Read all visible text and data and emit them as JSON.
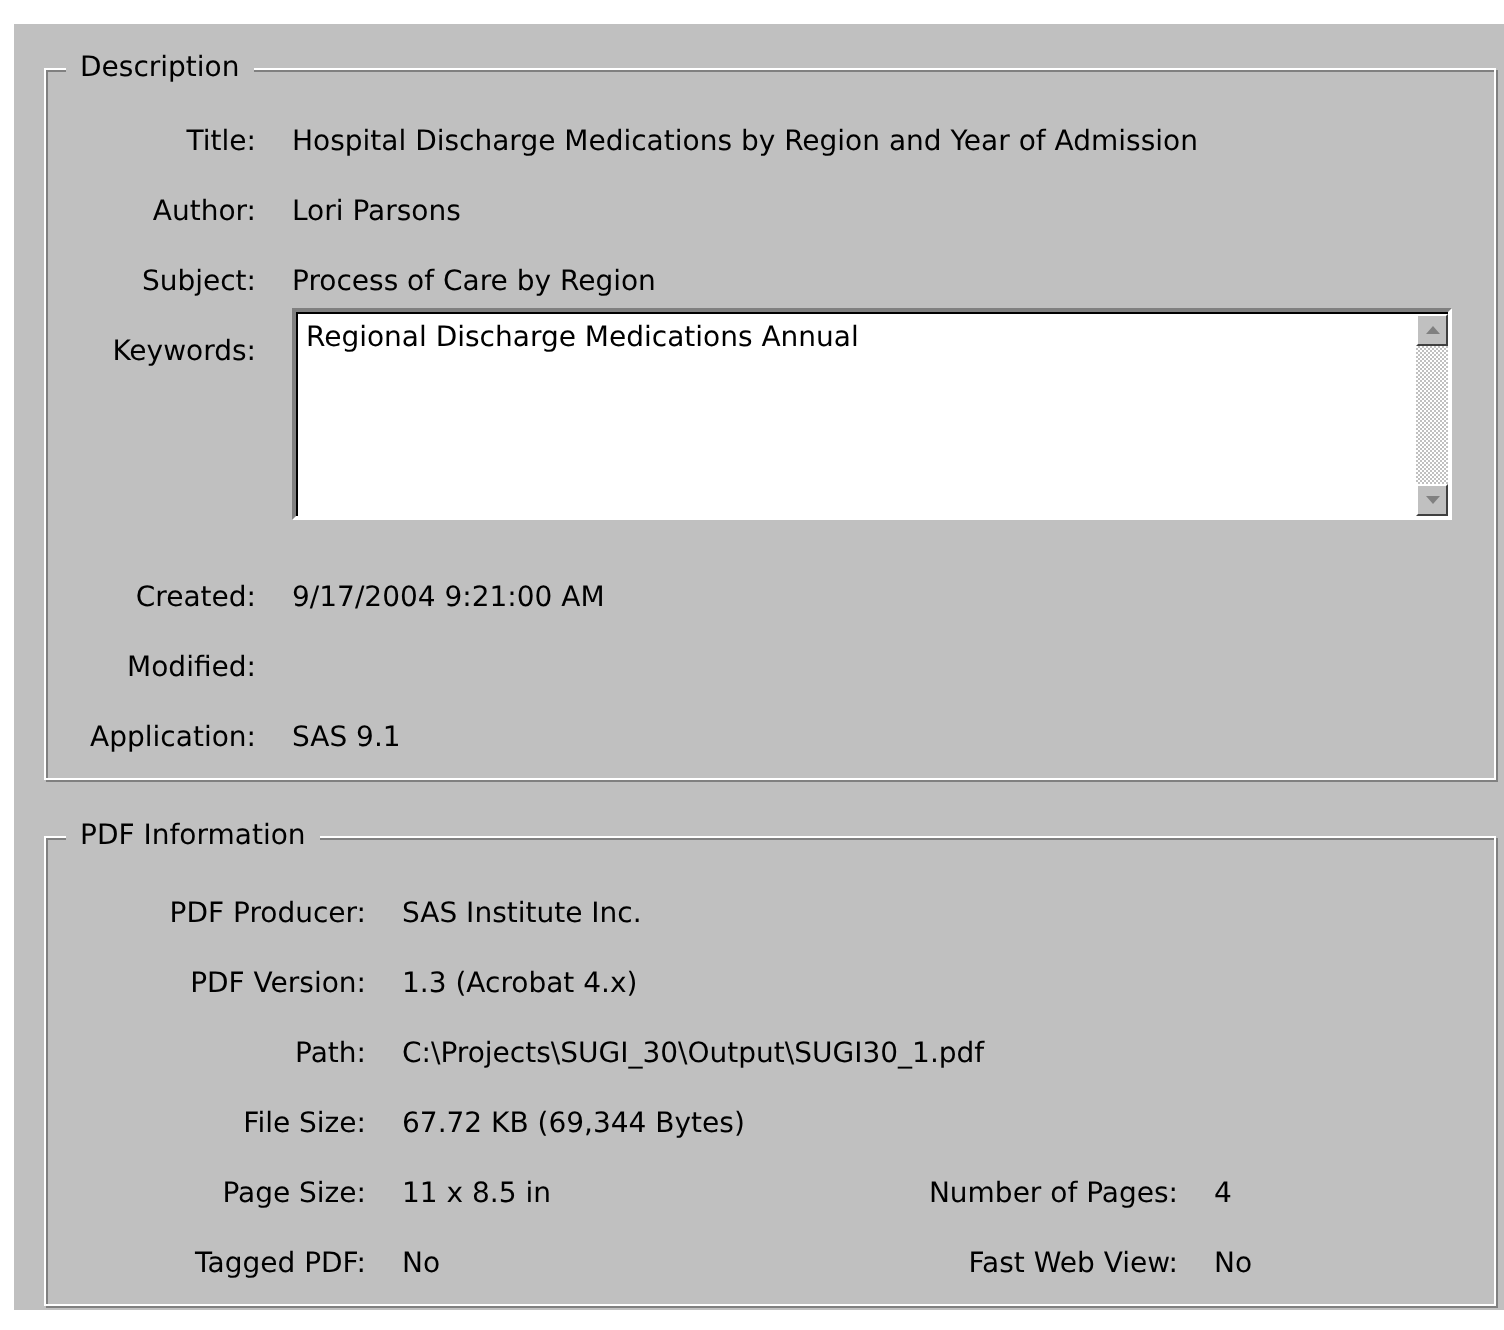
{
  "description": {
    "legend": "Description",
    "fields": [
      {
        "kind": "text",
        "label": "Title:",
        "value": "Hospital Discharge Medications by Region and Year of Admission"
      },
      {
        "kind": "text",
        "label": "Author:",
        "value": "Lori Parsons"
      },
      {
        "kind": "text",
        "label": "Subject:",
        "value": "Process of Care by Region"
      },
      {
        "kind": "textarea",
        "label": "Keywords:",
        "value": "Regional Discharge Medications Annual"
      },
      {
        "kind": "text",
        "label": "Created:",
        "value": "9/17/2004 9:21:00 AM"
      },
      {
        "kind": "text",
        "label": "Modified:"
      },
      {
        "kind": "text",
        "label": "Application:",
        "value": "SAS 9.1"
      }
    ]
  },
  "pdf_information": {
    "legend": "PDF Information",
    "rows": [
      {
        "label": "PDF Producer:",
        "value": "SAS Institute Inc."
      },
      {
        "label": "PDF Version:",
        "value": "1.3 (Acrobat 4.x)"
      },
      {
        "label": "Path:",
        "value": "C:\\Projects\\SUGI_30\\Output\\SUGI30_1.pdf"
      },
      {
        "label": "File Size:",
        "value": "67.72 KB (69,344 Bytes)"
      },
      {
        "label": "Page Size:",
        "value": "11 x 8.5 in",
        "right_label": "Number of Pages:",
        "right_value": "4"
      },
      {
        "label": "Tagged PDF:",
        "value": "No",
        "right_label": "Fast Web View:",
        "right_value": "No"
      }
    ]
  }
}
